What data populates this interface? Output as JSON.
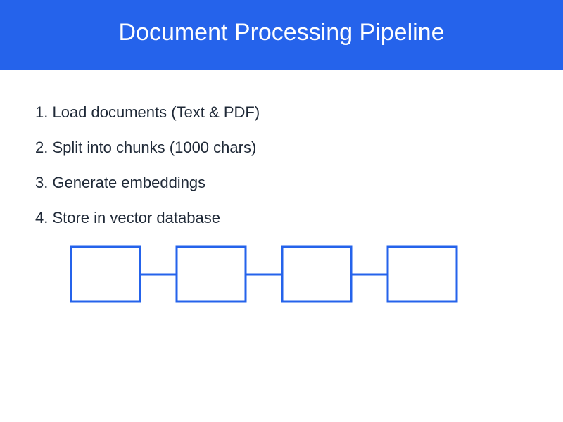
{
  "header": {
    "title": "Document Processing Pipeline"
  },
  "steps": [
    "1. Load documents (Text & PDF)",
    "2. Split into chunks (1000 chars)",
    "3. Generate embeddings",
    "4. Store in vector database"
  ],
  "flow": {
    "box_count": 4,
    "stroke_color": "#2563eb"
  },
  "colors": {
    "header_background": "#2563eb",
    "header_text": "#ffffff",
    "body_text": "#1f2937",
    "page_background": "#ffffff"
  }
}
